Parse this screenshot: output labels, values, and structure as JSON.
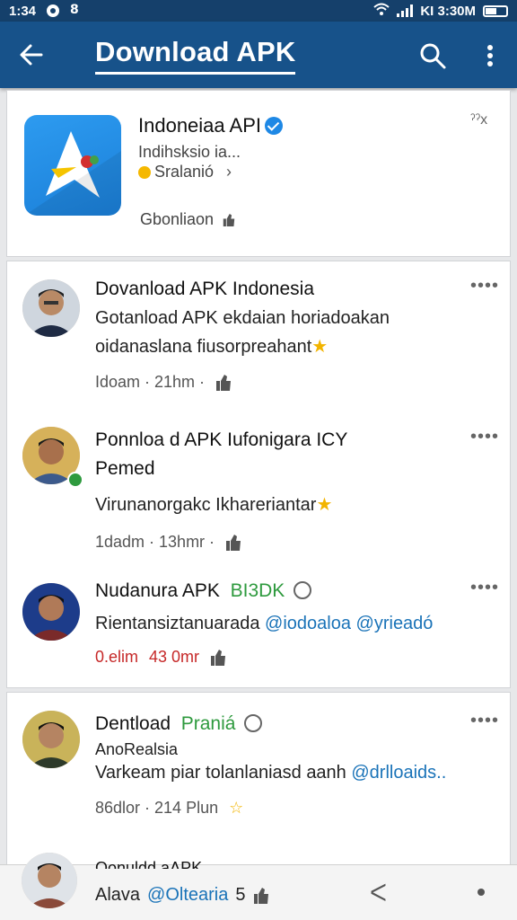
{
  "status": {
    "time": "1:34",
    "right": "KI 3:30M"
  },
  "appbar": {
    "title": "Download APK"
  },
  "app_card": {
    "name": "Indoneiaa API",
    "developer": "Indihsksio ia...",
    "rating_label": "Sralanió",
    "chevron": "›",
    "download_label": "Gbonliaon",
    "close": "ˀˀx"
  },
  "posts": [
    {
      "title": "Dovanload APK Indonesia",
      "line1": "Gotanload APK ekdaian horiadoakan",
      "line2": "oidanaslana fiusorpreahant",
      "meta": "Idoam · 21hm ·"
    },
    {
      "title_line1": "Ponnloa d APK Iufonigara ICY",
      "title_line2": "Pemed",
      "line1": "Virunanorgakc Ikhareriantar",
      "meta": "1dadm · 13hmr ·"
    },
    {
      "title": "Nudanura APK",
      "title_green": "BI3DK",
      "line1": "Rientansiztanuarada",
      "mention1": "@iodoaloa",
      "mention2": "@yrieadó",
      "meta_red": "0.elim",
      "meta_red2": "43 0mr"
    },
    {
      "title": "Dentload",
      "title_green": "Praniá",
      "subtitle": "AnoRealsia",
      "line1": "Varkeam piar tolanlaniasd aanh",
      "mention": "@drlloaids..",
      "meta": "86dlor · 214 Plun"
    }
  ],
  "bottom": {
    "title": "Oonuldd aAPK",
    "left": "Alava",
    "mention": "@Oltearia",
    "count": "5",
    "icon_right": "ᐸ"
  },
  "more_dots": "••••"
}
